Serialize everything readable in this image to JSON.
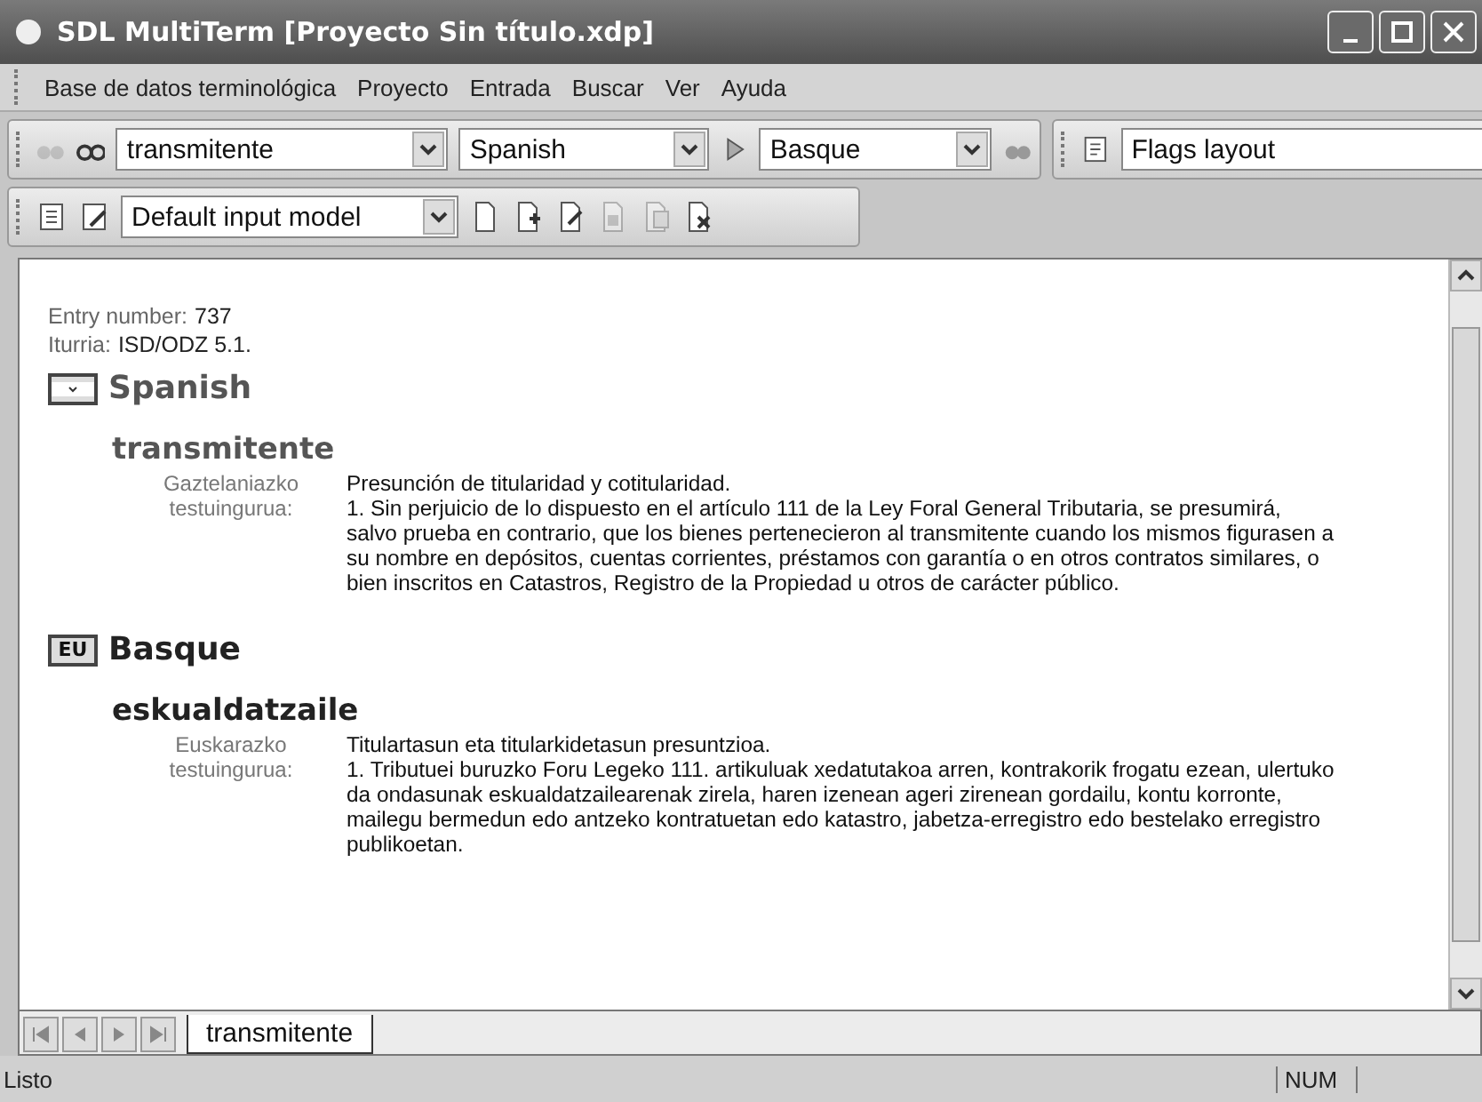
{
  "window": {
    "title": "SDL MultiTerm [Proyecto Sin título.xdp]"
  },
  "menu": [
    "Base de datos terminológica",
    "Proyecto",
    "Entrada",
    "Buscar",
    "Ver",
    "Ayuda"
  ],
  "search_toolbar": {
    "term": "transmitente",
    "source": "Spanish",
    "target": "Basque",
    "layout": "Flags layout"
  },
  "input_toolbar": {
    "model": "Default input model",
    "tools": [
      {
        "kind": "new",
        "disabled": false
      },
      {
        "kind": "add",
        "disabled": false
      },
      {
        "kind": "edit",
        "disabled": false
      },
      {
        "kind": "save",
        "disabled": true
      },
      {
        "kind": "copy",
        "disabled": true
      },
      {
        "kind": "delete",
        "disabled": false
      }
    ]
  },
  "entry": {
    "number_label": "Entry number:",
    "number": "737",
    "source_label": "Iturria:",
    "source": "ISD/ODZ 5.1.",
    "languages": [
      {
        "kind": "icon",
        "name": "Spanish",
        "term": "transmitente",
        "field_label": [
          "Gaztelaniazko",
          "testuingurua:"
        ],
        "context": [
          "Presunción de titularidad y cotitularidad.",
          "1. Sin perjuicio de lo dispuesto en el artículo 111 de la Ley Foral General Tributaria, se presumirá, salvo prueba en contrario, que los bienes pertenecieron al transmitente cuando los mismos figurasen a su nombre en depósitos, cuentas corrientes, préstamos con garantía o en otros contratos similares, o bien inscritos en Catastros, Registro de la Propiedad u otros de carácter público."
        ]
      },
      {
        "kind": "label",
        "flag_text": "EU",
        "name": "Basque",
        "term": "eskualdatzaile",
        "field_label": [
          "Euskarazko",
          "testuingurua:"
        ],
        "context": [
          "Titulartasun eta titularkidetasun presuntzioa.",
          "1. Tributuei buruzko Foru Legeko 111. artikuluak xedatutakoa arren, kontrakorik frogatu ezean, ulertuko da ondasunak eskualdatzailearenak zirela, haren izenean ageri zirenean gordailu, kontu korronte, mailegu bermedun edo antzeko kontratuetan edo katastro, jabetza-erregistro edo bestelako erregistro publikoetan."
        ]
      }
    ]
  },
  "tabs": [
    {
      "label": "transmitente",
      "selected": true
    }
  ],
  "status_bar": {
    "text": "Listo",
    "indicator": "NUM"
  }
}
